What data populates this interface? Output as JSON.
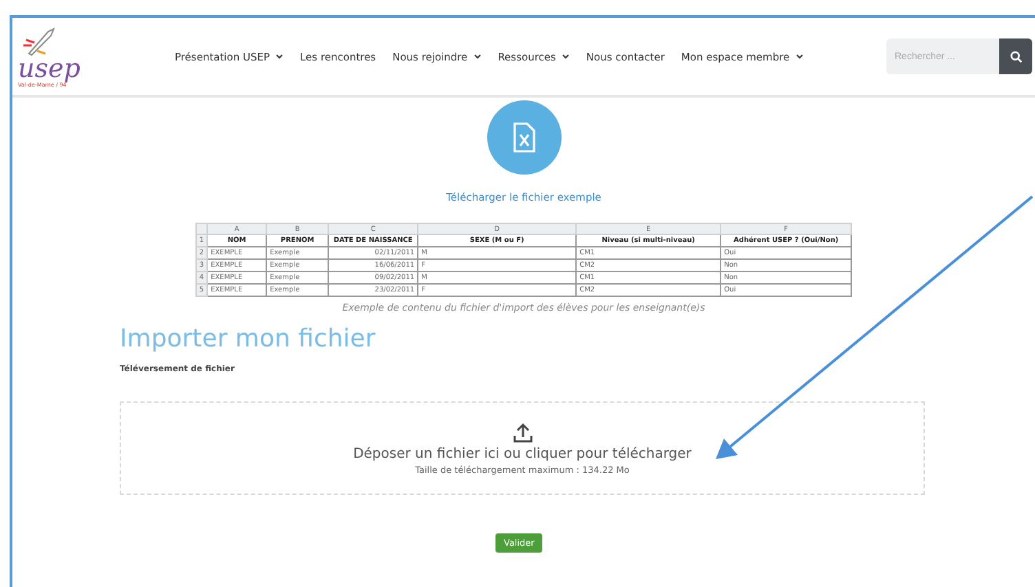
{
  "header": {
    "logo_text": "usep",
    "logo_subtext": "Val-de-Marne / 94",
    "nav": [
      {
        "label": "Présentation USEP",
        "has_menu": true
      },
      {
        "label": "Les rencontres",
        "has_menu": false
      },
      {
        "label": "Nous rejoindre",
        "has_menu": true
      },
      {
        "label": "Ressources",
        "has_menu": true
      },
      {
        "label": "Nous contacter",
        "has_menu": false
      },
      {
        "label": "Mon espace membre",
        "has_menu": true
      }
    ],
    "search": {
      "placeholder": "Rechercher ..."
    }
  },
  "download": {
    "label": "Télécharger le fichier exemple"
  },
  "spreadsheet": {
    "column_letters": [
      "A",
      "B",
      "C",
      "D",
      "E",
      "F"
    ],
    "rows": [
      [
        "NOM",
        "PRENOM",
        "DATE DE NAISSANCE",
        "SEXE (M ou F)",
        "Niveau (si multi-niveau)",
        "Adhérent USEP ? (Oui/Non)"
      ],
      [
        "EXEMPLE",
        "Exemple",
        "02/11/2011",
        "M",
        "CM1",
        "Oui"
      ],
      [
        "EXEMPLE",
        "Exemple",
        "16/06/2011",
        "F",
        "CM2",
        "Non"
      ],
      [
        "EXEMPLE",
        "Exemple",
        "09/02/2011",
        "M",
        "CM1",
        "Non"
      ],
      [
        "EXEMPLE",
        "Exemple",
        "23/02/2011",
        "F",
        "CM2",
        "Oui"
      ]
    ],
    "row_numbers": [
      "1",
      "2",
      "3",
      "4",
      "5"
    ],
    "caption": "Exemple de contenu du fichier d'import des élèves pour les enseignant(e)s"
  },
  "import": {
    "title": "Importer mon fichier",
    "subtitle": "Téléversement de fichier",
    "dropzone": {
      "label": "Déposer un fichier ici ou cliquer pour télécharger",
      "hint": "Taille de téléchargement maximum : 134.22 Mo"
    },
    "submit": "Valider"
  }
}
